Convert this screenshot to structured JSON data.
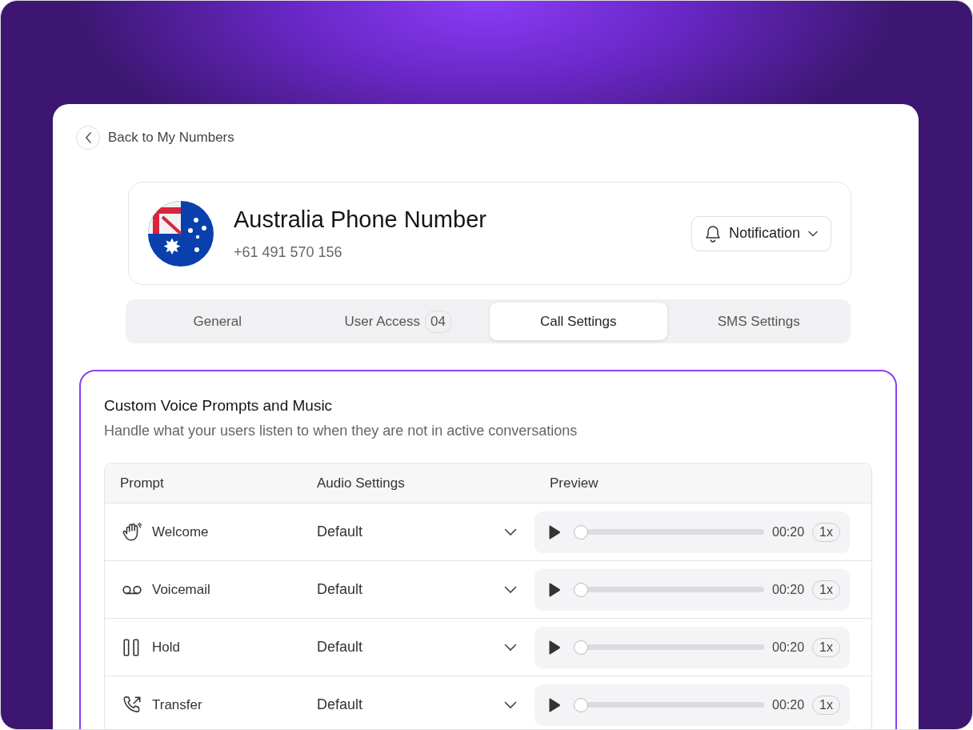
{
  "back_link": {
    "label": "Back to My Numbers"
  },
  "header": {
    "title": "Australia Phone Number",
    "phone": "+61 491 570 156",
    "notification_button": "Notification"
  },
  "tabs": [
    {
      "label": "General",
      "selected": false
    },
    {
      "label": "User Access",
      "badge": "04",
      "selected": false
    },
    {
      "label": "Call Settings",
      "selected": true
    },
    {
      "label": "SMS Settings",
      "selected": false
    }
  ],
  "section": {
    "title": "Custom Voice Prompts and Music",
    "subtitle": "Handle what your users listen to when they are not in active conversations",
    "table": {
      "columns": [
        "Prompt",
        "Audio Settings",
        "Preview"
      ],
      "rows": [
        {
          "kind": "wave",
          "name": "Welcome",
          "audio": "Default",
          "level": 0,
          "duration": "00:20",
          "speed": "1x"
        },
        {
          "kind": "voicemail",
          "name": "Voicemail",
          "audio": "Default",
          "level": 0,
          "duration": "00:20",
          "speed": "1x"
        },
        {
          "kind": "pause",
          "name": "Hold",
          "audio": "Default",
          "level": 0,
          "duration": "00:20",
          "speed": "1x"
        },
        {
          "kind": "transfer",
          "name": "Transfer",
          "audio": "Default",
          "level": 0,
          "duration": "00:20",
          "speed": "1x"
        }
      ]
    }
  }
}
